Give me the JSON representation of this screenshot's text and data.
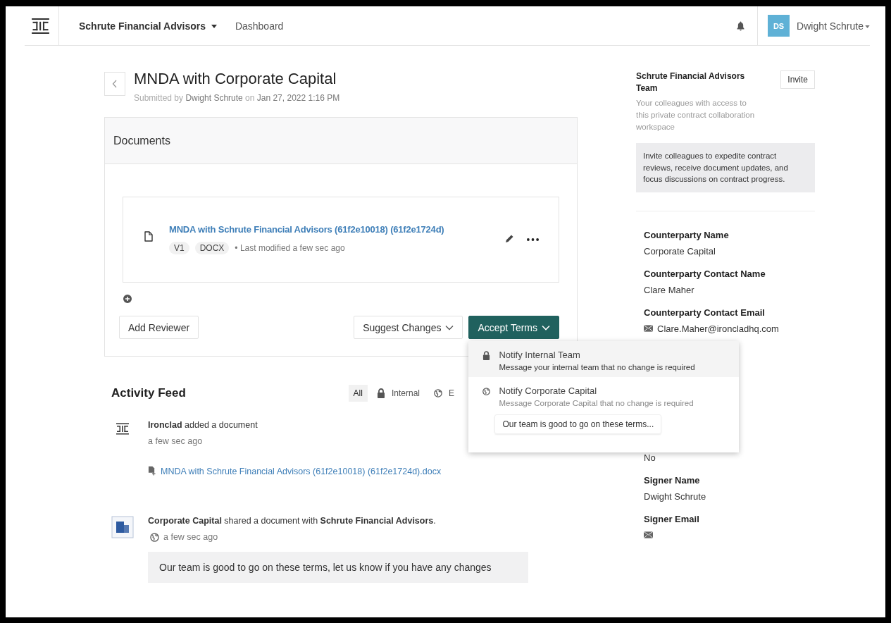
{
  "header": {
    "org": "Schrute Financial Advisors",
    "nav": "Dashboard",
    "avatar": "DS",
    "user": "Dwight Schrute"
  },
  "page": {
    "title": "MNDA with Corporate Capital",
    "submitted": "Submitted by **Dwight Schrute** on **Jan 27, 2022 1:16 PM**"
  },
  "documents": {
    "title": "Documents",
    "files": [
      {
        "name": "MNDA with Schrute Financial Advisors (61f2e10018) (61f2e1724d)",
        "tags": [
          "V1",
          "DOCX"
        ],
        "modified": "• Last modified a few sec ago"
      }
    ],
    "buttons": {
      "add_reviewer": "Add Reviewer",
      "suggest": "Suggest Changes",
      "accept": "Accept Terms"
    }
  },
  "accept_menu": [
    {
      "kind": "lock",
      "title": "Notify Internal Team",
      "description": "Message your internal team that no change is required",
      "selected": true
    },
    {
      "kind": "globe",
      "title": "Notify Corporate Capital",
      "description": "Message Corporate Capital that no change is required",
      "selected": false,
      "message": "Our team is good to go on these terms..."
    }
  ],
  "activity": {
    "title": "Activity Feed",
    "filters": [
      {
        "kind": "all",
        "label": "All",
        "selected": true
      },
      {
        "kind": "lock",
        "label": "Internal",
        "selected": false
      },
      {
        "kind": "globe",
        "label": "E",
        "selected": false
      }
    ],
    "items": [
      {
        "kind": "ironclad",
        "text": "**Ironclad** added a document",
        "time": "a few sec ago",
        "attachment": "MNDA with Schrute Financial Advisors (61f2e10018) (61f2e1724d).docx"
      },
      {
        "kind": "company",
        "text": "**Corporate Capital** shared a document with **Schrute Financial Advisors**.",
        "time": "a few sec ago",
        "message": "Our team is good to go on these terms, let us know if you have any changes"
      }
    ]
  },
  "sidebar": {
    "team_title": "Schrute Financial Advisors Team",
    "invite": "Invite",
    "team_desc": "Your colleagues with access to this private contract collaboration workspace",
    "tip": "Invite colleagues to expedite contract reviews, receive document updates, and focus discussions on contract progress.",
    "fields": [
      {
        "label": "Counterparty Name",
        "value": "Corporate Capital"
      },
      {
        "label": "Counterparty Contact Name",
        "value": "Clare Maher"
      },
      {
        "label": "Counterparty Contact Email",
        "kind": "email",
        "value": "Clare.Maher@ironcladhq.com"
      },
      {
        "value": "No"
      },
      {
        "label": "Signer Name",
        "value": "Dwight Schrute"
      },
      {
        "label": "Signer Email",
        "kind": "email"
      }
    ]
  }
}
